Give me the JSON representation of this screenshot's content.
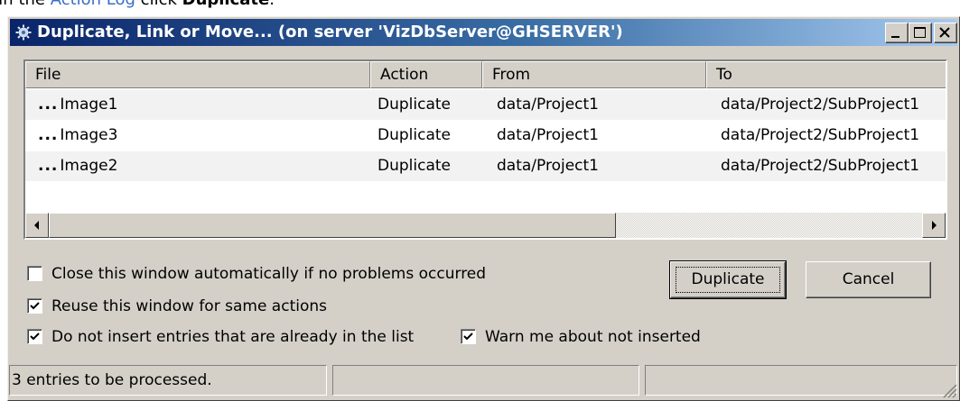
{
  "doc": {
    "prefix": "In the ",
    "link_text": "Action Log",
    "middle": " click ",
    "bold_word": "Duplicate",
    "suffix": "."
  },
  "dialog": {
    "title": "Duplicate, Link or Move... (on server 'VizDbServer@GHSERVER')",
    "icon": "gear-icon",
    "title_buttons": [
      "minimize",
      "maximize",
      "close"
    ]
  },
  "table": {
    "columns": [
      "File",
      "Action",
      "From",
      "To"
    ],
    "rows": [
      {
        "file": "Image1",
        "action": "Duplicate",
        "from": "data/Project1",
        "to": "data/Project2/SubProject1"
      },
      {
        "file": "Image3",
        "action": "Duplicate",
        "from": "data/Project1",
        "to": "data/Project2/SubProject1"
      },
      {
        "file": "Image2",
        "action": "Duplicate",
        "from": "data/Project1",
        "to": "data/Project2/SubProject1"
      }
    ],
    "row_prefix": "..."
  },
  "options": {
    "close_auto": {
      "label": "Close this window automatically if no problems occurred",
      "checked": false
    },
    "reuse_window": {
      "label": "Reuse this window for same actions",
      "checked": true
    },
    "no_insert_existing": {
      "label": "Do not insert entries that are already in the list",
      "checked": true
    },
    "warn_not_inserted": {
      "label": "Warn me about not inserted",
      "checked": true
    }
  },
  "buttons": {
    "duplicate": "Duplicate",
    "cancel": "Cancel"
  },
  "status": {
    "message": "3 entries to be processed.",
    "panel2": "",
    "panel3": ""
  },
  "colors": {
    "title_gradient_start": "#0a246a",
    "title_gradient_end": "#a6caf0",
    "face": "#d4d0c8",
    "link": "#3a6fc8"
  }
}
